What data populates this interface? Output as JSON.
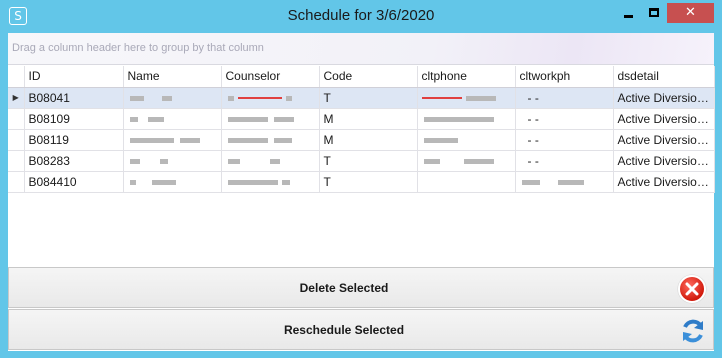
{
  "window": {
    "title": "Schedule for 3/6/2020",
    "app_icon_glyph": "S",
    "minimize_glyph": "",
    "maximize_glyph": "",
    "close_glyph": "✕"
  },
  "groupbar": {
    "hint": "Drag a column header here to group by that column"
  },
  "grid": {
    "row_indicator": "▶",
    "columns": [
      "ID",
      "Name",
      "Counselor",
      "Code",
      "cltphone",
      "cltworkph",
      "dsdetail"
    ],
    "rows": [
      {
        "id": "B08041",
        "name": "",
        "counselor": "",
        "code": "T",
        "cltphone": "",
        "cltworkph": "-   -",
        "dsdetail": "Active Diversion Pro"
      },
      {
        "id": "B08109",
        "name": "",
        "counselor": "",
        "code": "M",
        "cltphone": "",
        "cltworkph": "-   -",
        "dsdetail": "Active Diversion Pro"
      },
      {
        "id": "B08119",
        "name": "",
        "counselor": "",
        "code": "M",
        "cltphone": "",
        "cltworkph": "-   -",
        "dsdetail": "Active Diversion Pro"
      },
      {
        "id": "B08283",
        "name": "",
        "counselor": "",
        "code": "T",
        "cltphone": "",
        "cltworkph": "-   -",
        "dsdetail": "Active Diversion Pro"
      },
      {
        "id": "B084410",
        "name": "",
        "counselor": "",
        "code": "T",
        "cltphone": "",
        "cltworkph": "",
        "dsdetail": "Active Diversion Pro"
      }
    ]
  },
  "actions": {
    "delete_label": "Delete Selected",
    "reschedule_label": "Reschedule Selected",
    "delete_icon": "red-circle-x-icon",
    "reschedule_icon": "blue-refresh-icon"
  },
  "colors": {
    "titlebar": "#62c6e8",
    "close_button": "#c75050",
    "selected_row": "#dde6f4"
  }
}
